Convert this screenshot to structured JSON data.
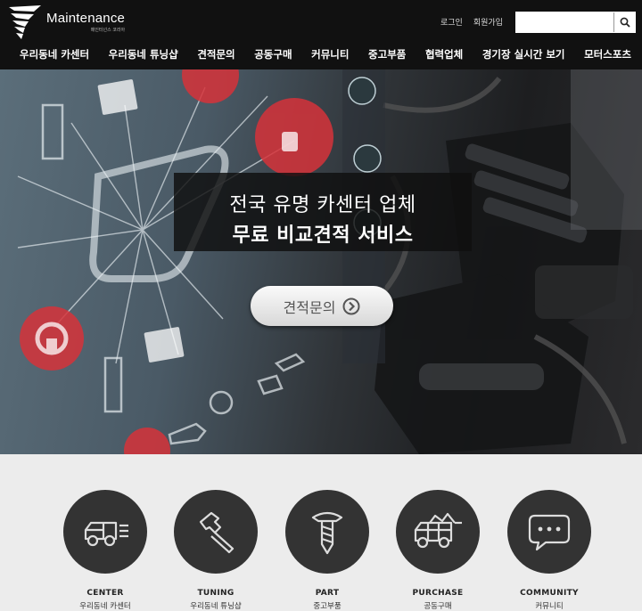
{
  "brand": {
    "name": "Maintenance",
    "sub": "메인터넌스 코리아"
  },
  "top_links": {
    "login": "로그인",
    "signup": "회원가입"
  },
  "search": {
    "value": "",
    "placeholder": ""
  },
  "nav": [
    "우리동네 카센터",
    "우리동네 튜닝샵",
    "견적문의",
    "공동구매",
    "커뮤니티",
    "중고부품",
    "협력업체",
    "경기장 실시간 보기",
    "모터스포츠"
  ],
  "hero": {
    "line1": "전국 유명 카센터 업체",
    "line2": "무료 비교견적 서비스",
    "button_label": "견적문의"
  },
  "services": [
    {
      "en": "CENTER",
      "ko": "우리동네 카센터",
      "icon": "truck-icon"
    },
    {
      "en": "TUNING",
      "ko": "우리동네 튜닝샵",
      "icon": "hammer-icon"
    },
    {
      "en": "PART",
      "ko": "중고부품",
      "icon": "screw-icon"
    },
    {
      "en": "PURCHASE",
      "ko": "공동구매",
      "icon": "cart-icon"
    },
    {
      "en": "COMMUNITY",
      "ko": "커뮤니티",
      "icon": "chat-bubble-icon"
    }
  ],
  "colors": {
    "header_bg": "#111111",
    "service_circle": "#333333",
    "accent_red": "#d6323a",
    "page_bg": "#ececec"
  }
}
